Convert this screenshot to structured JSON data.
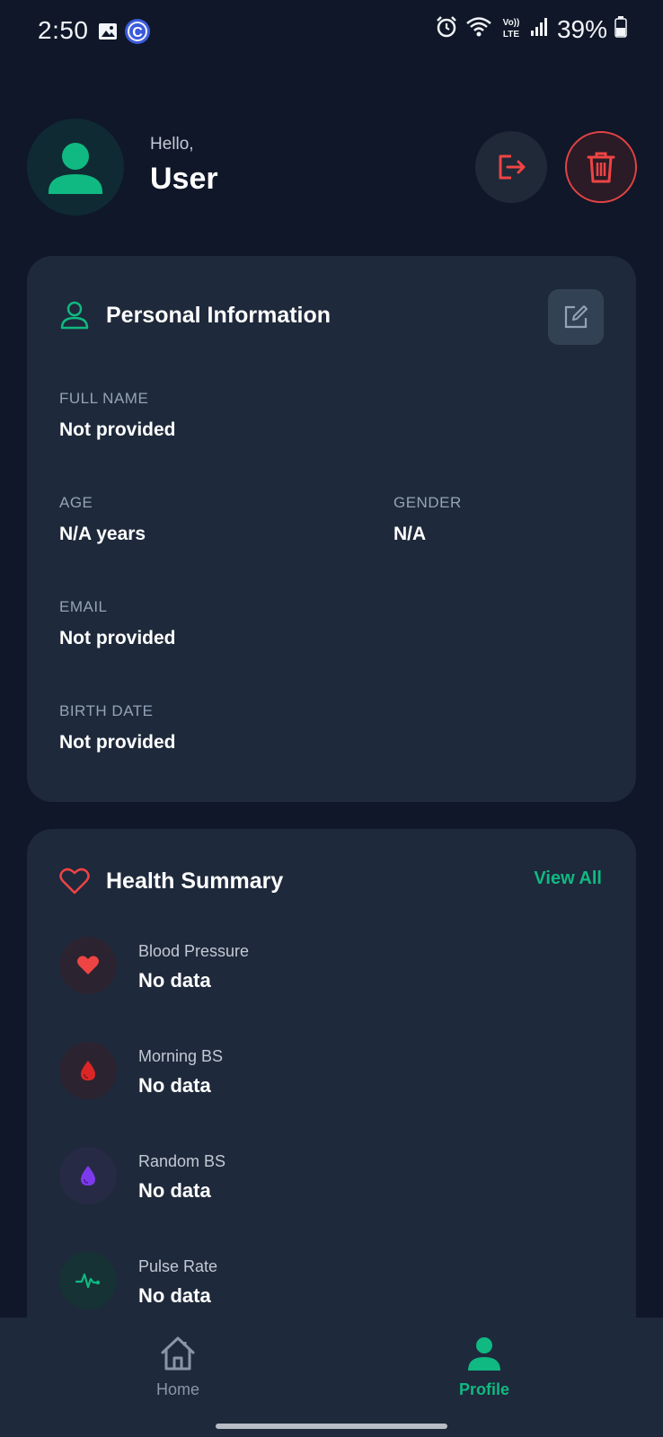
{
  "status_bar": {
    "time": "2:50",
    "battery": "39%",
    "icons": [
      "gallery-icon",
      "c-app-icon",
      "alarm-icon",
      "wifi-icon",
      "volte-icon",
      "signal-icon",
      "battery-icon"
    ]
  },
  "header": {
    "greeting": "Hello,",
    "username": "User",
    "actions": [
      "logout-icon",
      "trash-icon"
    ]
  },
  "personal_info": {
    "title": "Personal Information",
    "fields": [
      {
        "label": "FULL NAME",
        "value": "Not provided"
      },
      {
        "label": "AGE",
        "value": "N/A years"
      },
      {
        "label": "GENDER",
        "value": "N/A"
      },
      {
        "label": "EMAIL",
        "value": "Not provided"
      },
      {
        "label": "BIRTH DATE",
        "value": "Not provided"
      }
    ]
  },
  "health_summary": {
    "title": "Health Summary",
    "view_all": "View All",
    "metrics": [
      {
        "label": "Blood Pressure",
        "value": "No data",
        "icon": "heart-icon",
        "color": "#ef4444"
      },
      {
        "label": "Morning BS",
        "value": "No data",
        "icon": "blood-drop-icon",
        "color": "#dc2626"
      },
      {
        "label": "Random BS",
        "value": "No data",
        "icon": "blood-drop-icon",
        "color": "#7c3aed"
      },
      {
        "label": "Pulse Rate",
        "value": "No data",
        "icon": "pulse-icon",
        "color": "#10b981"
      }
    ]
  },
  "bottom_nav": {
    "items": [
      {
        "label": "Home",
        "icon": "home-icon",
        "active": false
      },
      {
        "label": "Profile",
        "icon": "profile-icon",
        "active": true
      }
    ]
  },
  "colors": {
    "background": "#0f1729",
    "card": "#1e293b",
    "accent": "#10b981",
    "danger": "#e24343",
    "muted": "#94a3b8"
  }
}
